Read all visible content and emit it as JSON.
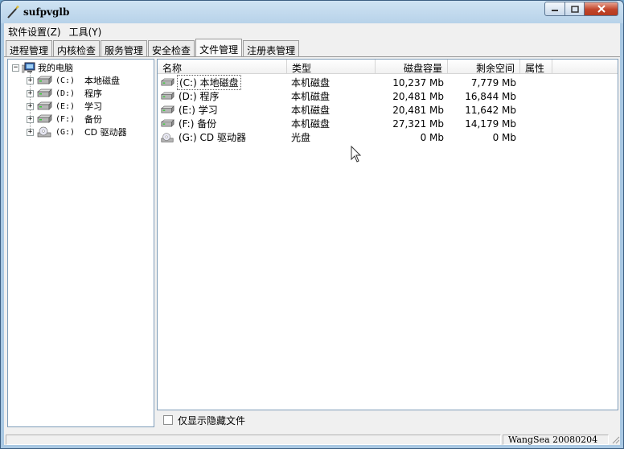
{
  "window": {
    "title": "sufpvglb"
  },
  "menu": [
    {
      "label": "软件设置(Z)"
    },
    {
      "label": "工具(Y)"
    }
  ],
  "tabs": [
    {
      "label": "进程管理"
    },
    {
      "label": "内核检查"
    },
    {
      "label": "服务管理"
    },
    {
      "label": "安全检查"
    },
    {
      "label": "文件管理",
      "active": true
    },
    {
      "label": "注册表管理"
    }
  ],
  "tree": {
    "root": {
      "label": "我的电脑",
      "expander": "−"
    },
    "items": [
      {
        "letter": "(C:)",
        "label": "本地磁盘",
        "expander": "+",
        "icon": "hard-drive-icon"
      },
      {
        "letter": "(D:)",
        "label": "程序",
        "expander": "+",
        "icon": "hard-drive-icon"
      },
      {
        "letter": "(E:)",
        "label": "学习",
        "expander": "+",
        "icon": "hard-drive-icon"
      },
      {
        "letter": "(F:)",
        "label": "备份",
        "expander": "+",
        "icon": "hard-drive-icon"
      },
      {
        "letter": "(G:)",
        "label": "CD 驱动器",
        "expander": "+",
        "icon": "cd-drive-icon"
      }
    ]
  },
  "list": {
    "columns": [
      "名称",
      "类型",
      "磁盘容量",
      "剩余空间",
      "属性"
    ],
    "rows": [
      {
        "name": "(C:) 本地磁盘",
        "type": "本机磁盘",
        "capacity": "10,237 Mb",
        "free": "7,779 Mb",
        "icon": "hard-drive-icon",
        "selected": true
      },
      {
        "name": "(D:) 程序",
        "type": "本机磁盘",
        "capacity": "20,481 Mb",
        "free": "16,844 Mb",
        "icon": "hard-drive-icon"
      },
      {
        "name": "(E:) 学习",
        "type": "本机磁盘",
        "capacity": "20,481 Mb",
        "free": "11,642 Mb",
        "icon": "hard-drive-icon"
      },
      {
        "name": "(F:) 备份",
        "type": "本机磁盘",
        "capacity": "27,321 Mb",
        "free": "14,179 Mb",
        "icon": "hard-drive-icon"
      },
      {
        "name": "(G:) CD 驱动器",
        "type": "光盘",
        "capacity": "0 Mb",
        "free": "0 Mb",
        "icon": "cd-drive-icon"
      }
    ]
  },
  "options": {
    "show_hidden_label": "仅显示隐藏文件"
  },
  "status": {
    "author": "WangSea 20080204"
  },
  "colors": {
    "accent_border": "#7f9db9",
    "titlebar": "#b7d2e9",
    "close_button": "#c2452a"
  }
}
